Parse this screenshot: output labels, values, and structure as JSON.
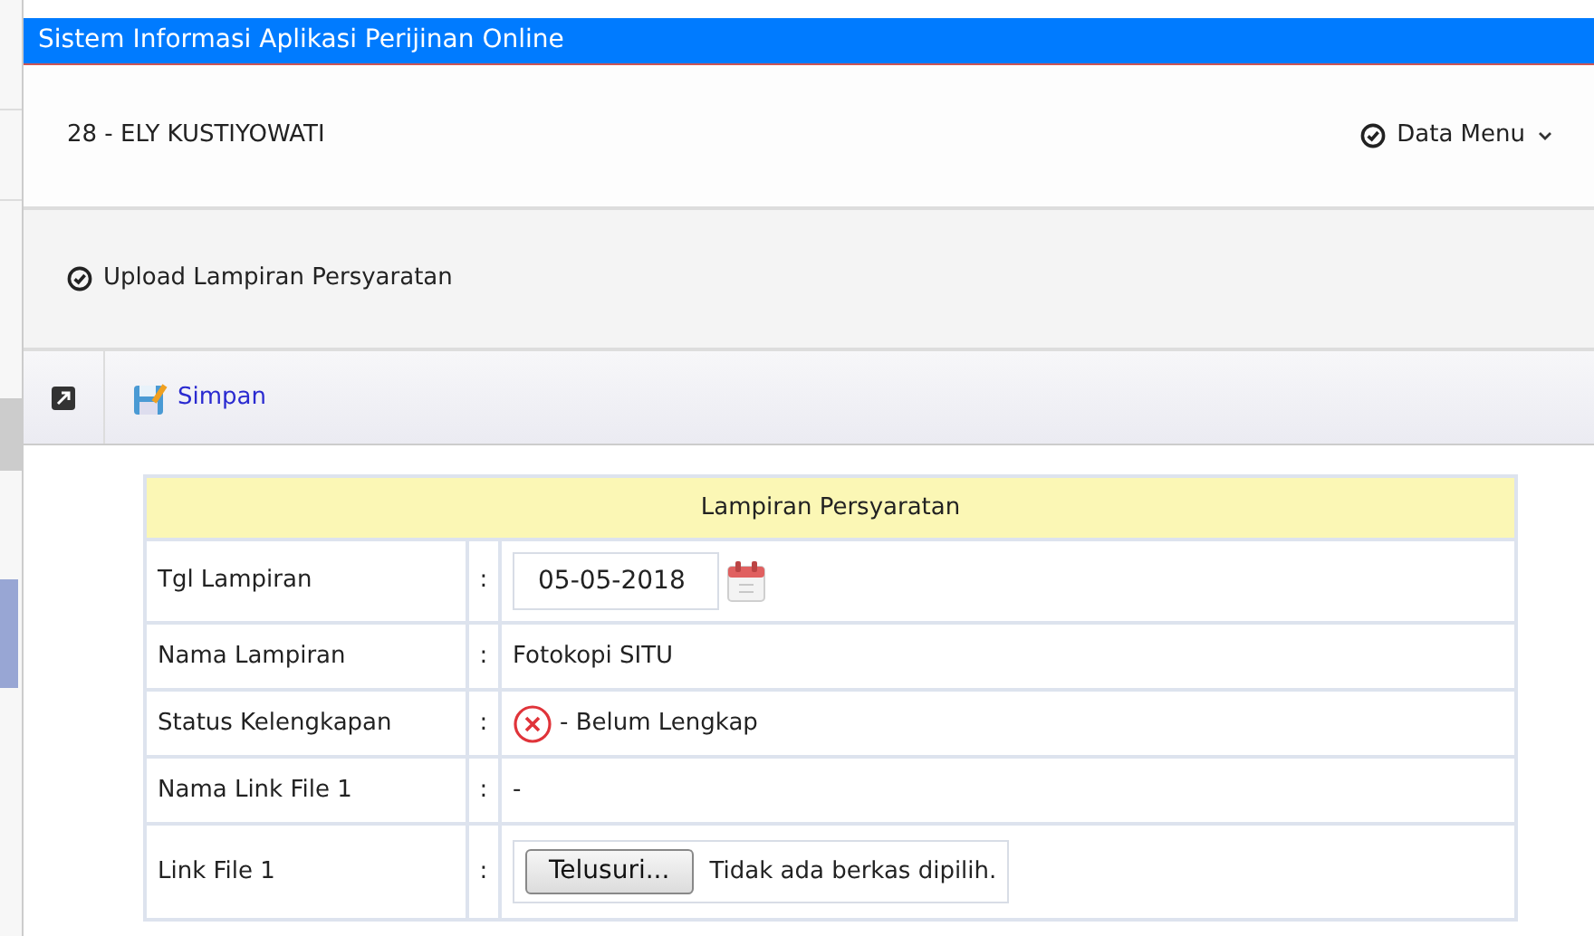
{
  "window": {
    "title": "Sistem Informasi Aplikasi Perijinan Online"
  },
  "header": {
    "user": "28 - ELY KUSTIYOWATI",
    "menu": "Data Menu"
  },
  "section": {
    "title": "Upload Lampiran Persyaratan"
  },
  "toolbar": {
    "save": "Simpan"
  },
  "form": {
    "title": "Lampiran Persyaratan",
    "rows": [
      {
        "kind": "date",
        "label": "Tgl Lampiran",
        "sep": ":",
        "value": "05-05-2018"
      },
      {
        "kind": "text",
        "label": "Nama Lampiran",
        "sep": ":",
        "value": "Fotokopi SITU"
      },
      {
        "kind": "status",
        "label": "Status Kelengkapan",
        "sep": ":",
        "value": "- Belum Lengkap"
      },
      {
        "kind": "text",
        "label": "Nama Link File 1",
        "sep": ":",
        "value": "-"
      },
      {
        "kind": "file",
        "label": "Link File 1",
        "sep": ":",
        "button": "Telusuri...",
        "value": "Tidak ada berkas dipilih."
      }
    ]
  }
}
